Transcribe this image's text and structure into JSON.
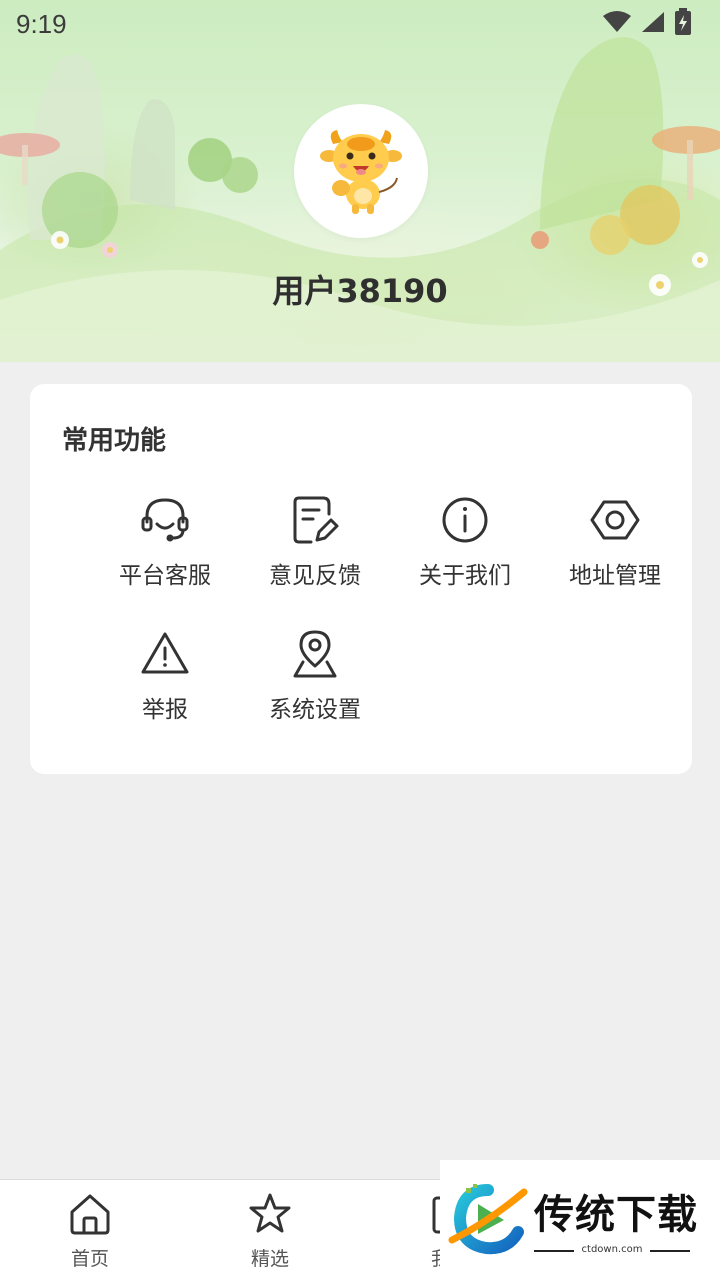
{
  "status_bar": {
    "time": "9:19"
  },
  "profile": {
    "username": "用户38190"
  },
  "section": {
    "title": "常用功能",
    "items": [
      {
        "label": "平台客服",
        "icon": "headset-icon"
      },
      {
        "label": "意见反馈",
        "icon": "feedback-edit-icon"
      },
      {
        "label": "关于我们",
        "icon": "info-icon"
      },
      {
        "label": "地址管理",
        "icon": "hexagon-nut-icon"
      },
      {
        "label": "举报",
        "icon": "warning-icon"
      },
      {
        "label": "系统设置",
        "icon": "location-pin-icon"
      }
    ]
  },
  "tabbar": {
    "items": [
      {
        "label": "首页",
        "icon": "home-icon"
      },
      {
        "label": "精选",
        "icon": "star-icon"
      },
      {
        "label": "我的",
        "icon": "profile-icon"
      }
    ]
  },
  "watermark": {
    "title": "传统下载",
    "subtitle": "ctdown.com"
  },
  "colors": {
    "page_bg": "#efefef",
    "card_bg": "#ffffff",
    "text": "#333333",
    "banner_green": "#cdecc0"
  }
}
